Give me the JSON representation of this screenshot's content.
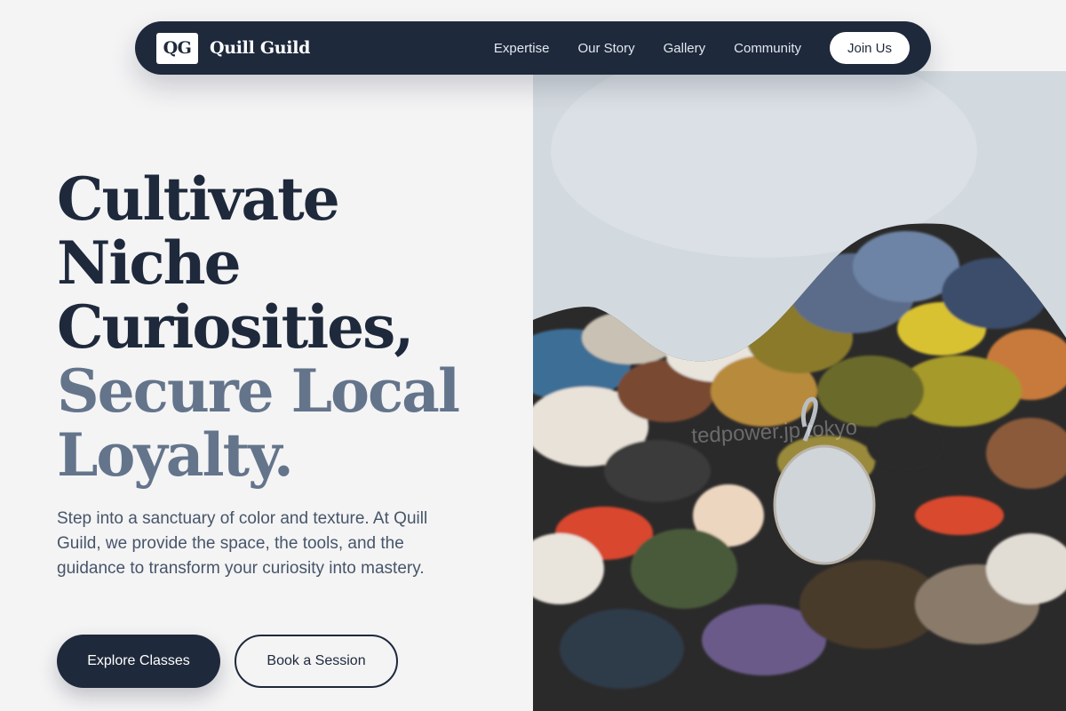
{
  "brand": {
    "logo_text": "QG",
    "name": "Quill Guild"
  },
  "nav": {
    "links": [
      "Expertise",
      "Our Story",
      "Gallery",
      "Community"
    ],
    "cta": "Join Us"
  },
  "hero": {
    "headline_dark": [
      "Cultivate",
      "Niche",
      "Curiosities,"
    ],
    "headline_muted": [
      "Secure Local",
      "Loyalty."
    ],
    "description": "Step into a sanctuary of color and texture. At Quill Guild, we provide the space, the tools, and the guidance to transform your curiosity into mastery.",
    "primary_cta": "Explore Classes",
    "secondary_cta": "Book a Session",
    "image_watermark": "tedpower.jp tokyo"
  },
  "colors": {
    "navy": "#1e293b",
    "muted": "#64748b",
    "background": "#f4f4f5",
    "body_text": "#475569"
  }
}
